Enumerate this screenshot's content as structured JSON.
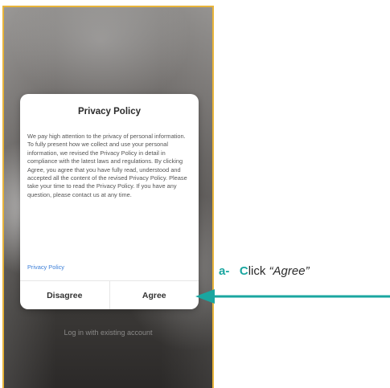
{
  "dialog": {
    "title": "Privacy Policy",
    "body": "We pay high attention to the privacy of personal information. To fully present how we collect and use your personal information, we revised the Privacy Policy in detail in compliance with the latest laws and regulations. By clicking Agree, you agree that you have fully read, understood and accepted all the content of the revised Privacy Policy. Please take your time to read the Privacy Policy. If you have any question, please contact us at any time.",
    "link_label": "Privacy Policy",
    "disagree_label": "Disagree",
    "agree_label": "Agree"
  },
  "background": {
    "login_link": "Log in with existing account"
  },
  "annotation": {
    "step": "a-",
    "first_letter": "C",
    "rest": "lick ",
    "quoted": "“Agree”"
  },
  "colors": {
    "accent_teal": "#1aa6a0",
    "link_blue": "#3c7fd8",
    "frame_border": "#e8b43a"
  }
}
